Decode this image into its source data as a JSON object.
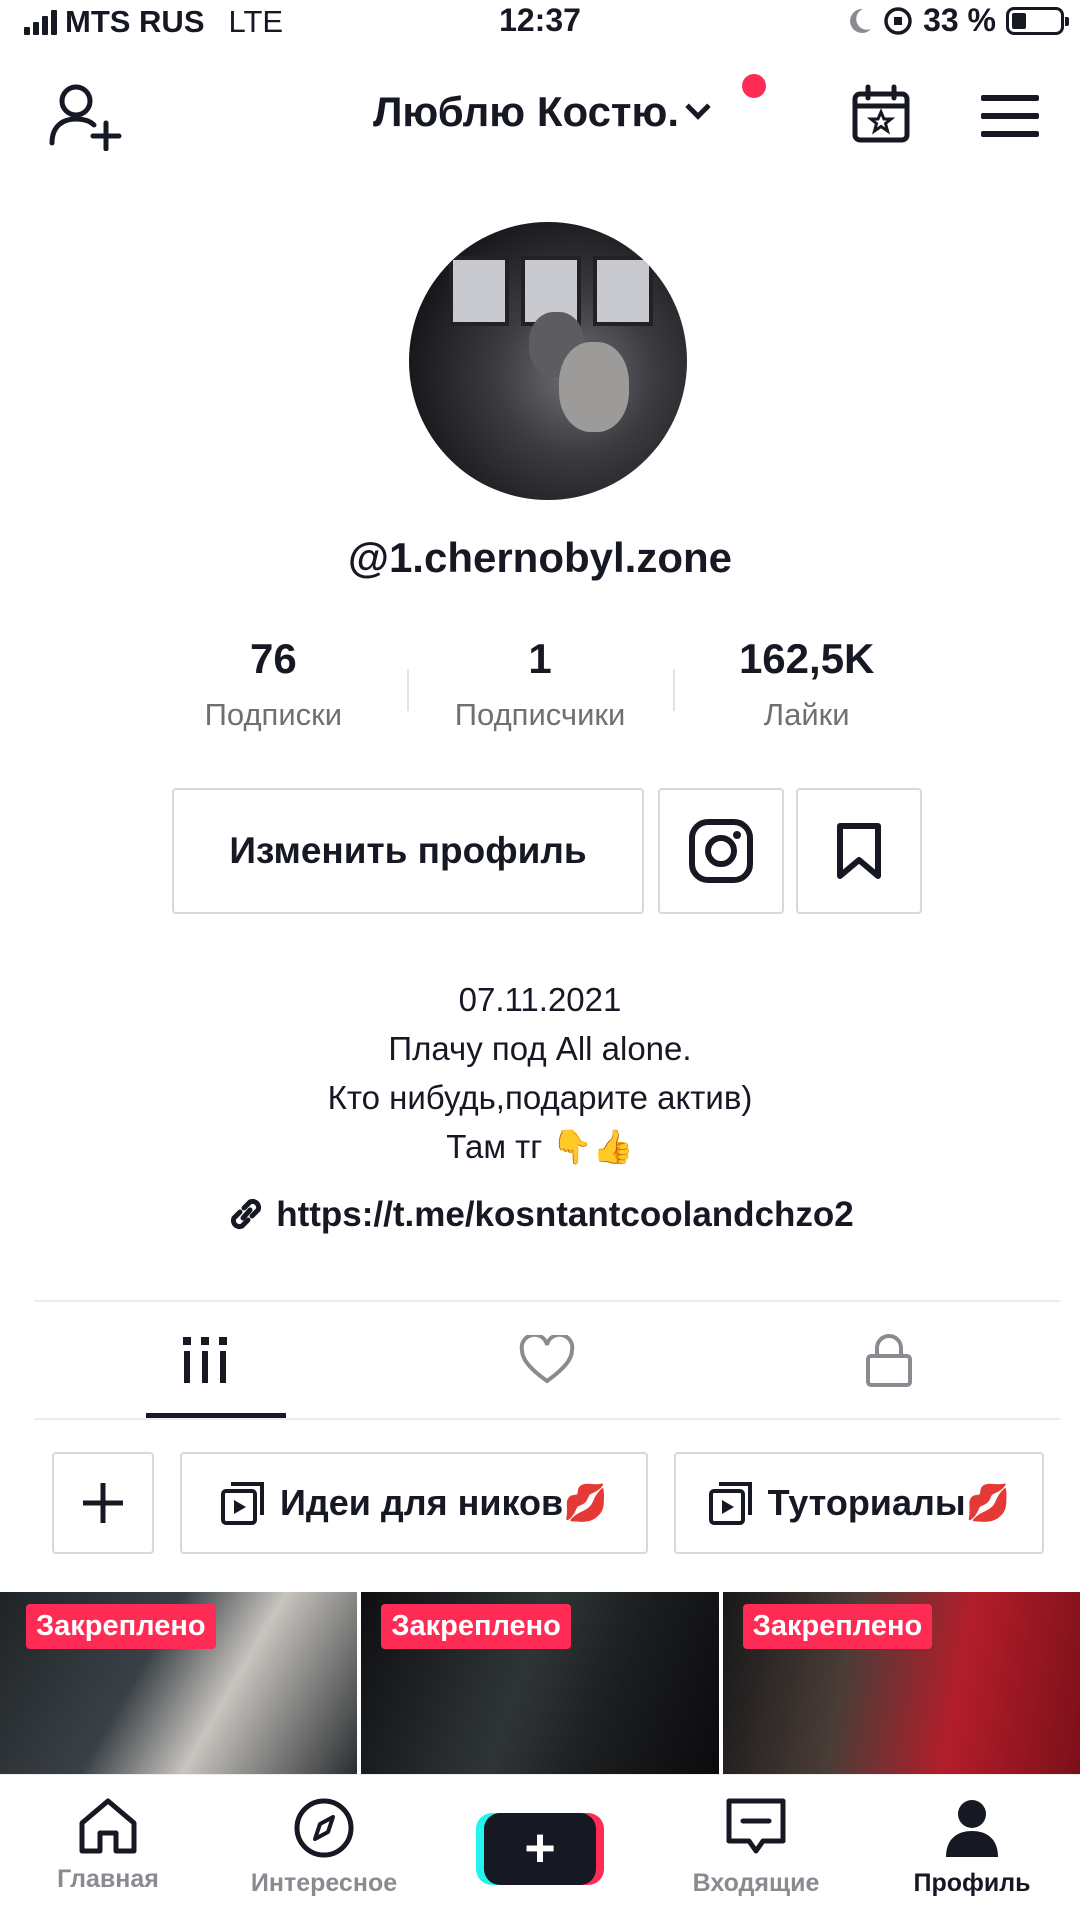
{
  "status_bar": {
    "carrier": "MTS RUS",
    "network": "LTE",
    "time": "12:37",
    "battery": "33 %"
  },
  "header": {
    "title": "Люблю Костю.",
    "icons": [
      "add-user-icon",
      "chevron-down-icon",
      "calendar-star-icon",
      "menu-icon"
    ],
    "notification_color": "#fe2c55"
  },
  "profile": {
    "username": "@1.chernobyl.zone",
    "stats": [
      {
        "value": "76",
        "label": "Подписки"
      },
      {
        "value": "1",
        "label": "Подписчики"
      },
      {
        "value": "162,5K",
        "label": "Лайки"
      }
    ],
    "edit_button": "Изменить профиль",
    "bio_lines": [
      "07.11.2021",
      "Плачу под All alone.",
      "Кто нибудь,подарите актив)",
      "Там тг 👇👍"
    ],
    "link": "https://t.me/kosntantcoolandchzo2"
  },
  "tabs": [
    {
      "icon": "grid-icon",
      "active": true
    },
    {
      "icon": "heart-icon",
      "active": false
    },
    {
      "icon": "lock-icon",
      "active": false
    }
  ],
  "playlists": [
    {
      "label": "Идеи для ников💋"
    },
    {
      "label": "Туториалы💋"
    }
  ],
  "videos": [
    {
      "badge": "Закреплено"
    },
    {
      "badge": "Закреплено"
    },
    {
      "badge": "Закреплено"
    }
  ],
  "bottom_nav": [
    {
      "label": "Главная",
      "icon": "home-icon"
    },
    {
      "label": "Интересное",
      "icon": "compass-icon"
    },
    {
      "label": "",
      "icon": "plus-icon"
    },
    {
      "label": "Входящие",
      "icon": "inbox-icon"
    },
    {
      "label": "Профиль",
      "icon": "profile-icon",
      "active": true
    }
  ],
  "colors": {
    "accent": "#fe2c55",
    "cyan": "#25f4ee",
    "text": "#161823",
    "muted": "#8a8b91"
  }
}
